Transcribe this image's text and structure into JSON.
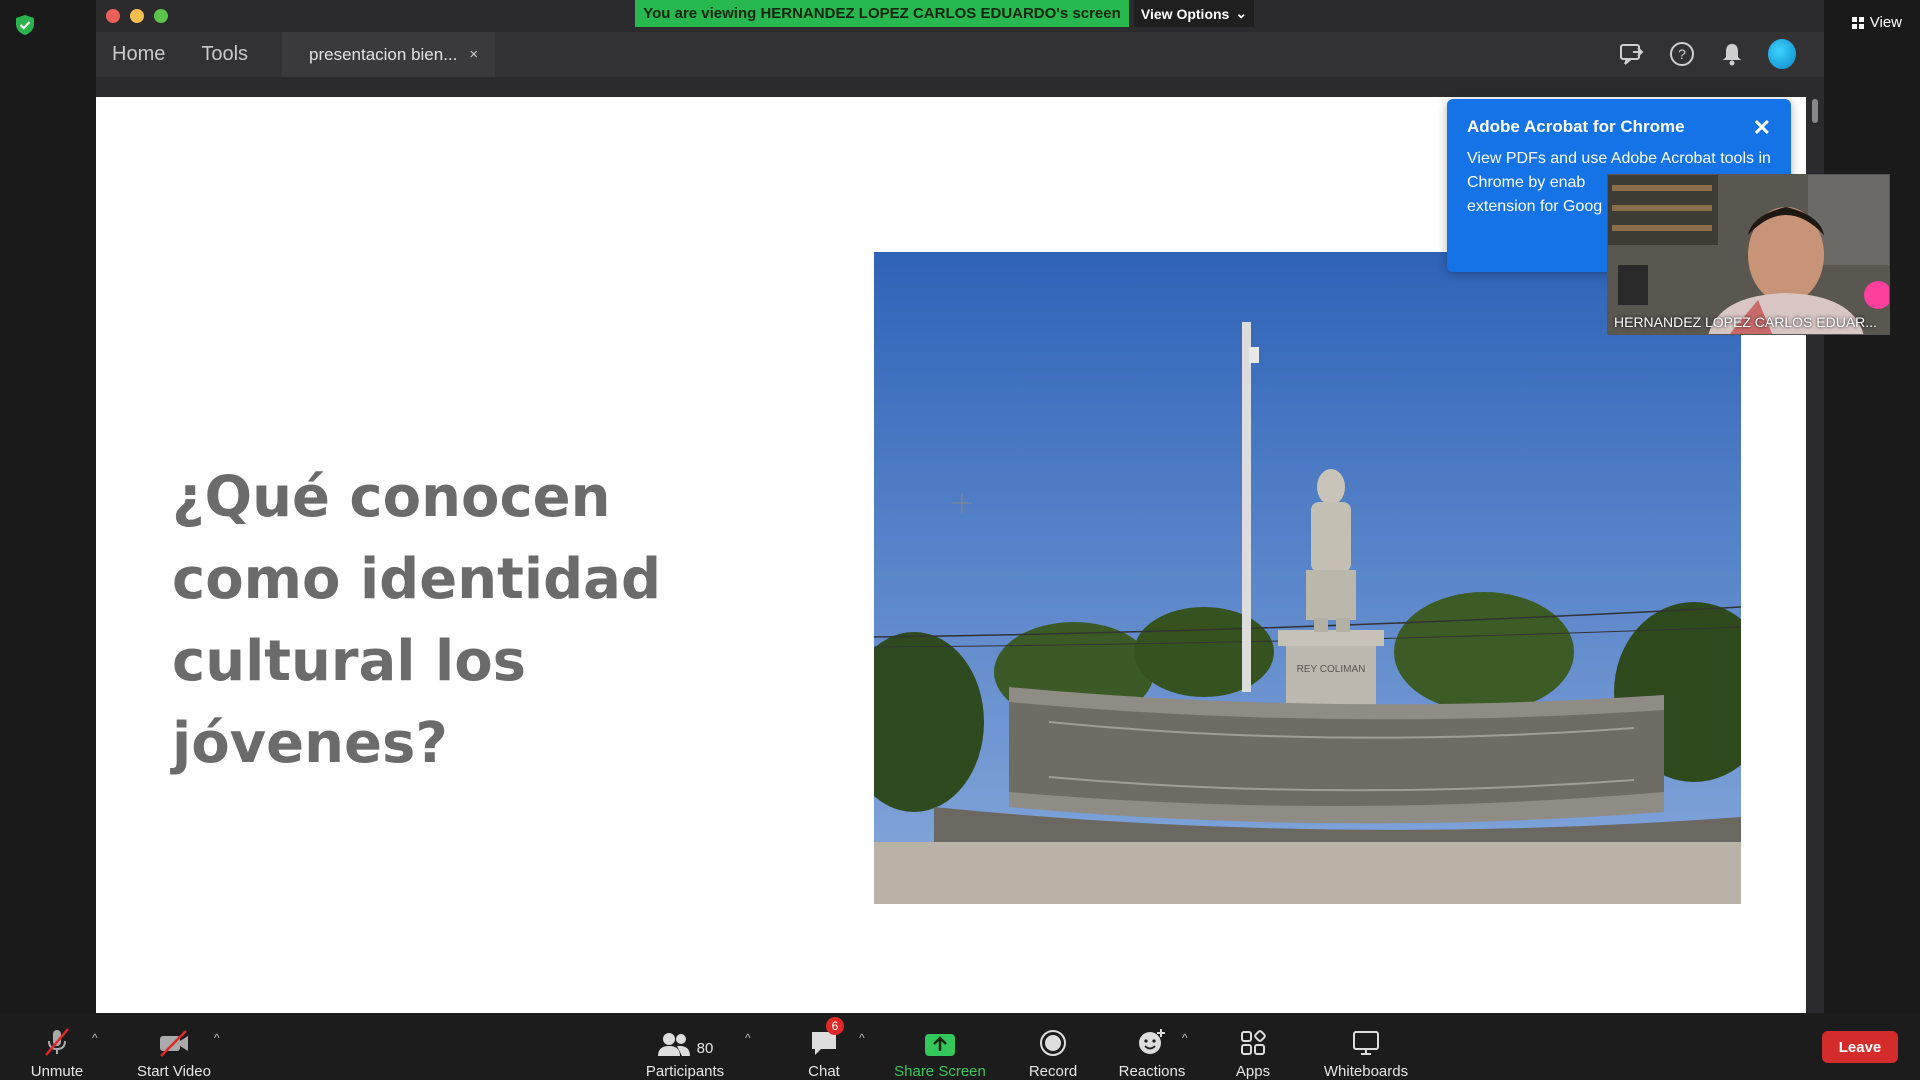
{
  "zoom": {
    "view_label": "View",
    "banner_text": "You are viewing HERNANDEZ LOPEZ CARLOS EDUARDO's screen",
    "view_options_label": "View Options",
    "view_options_caret": "⌄"
  },
  "acrobat": {
    "nav": {
      "home": "Home",
      "tools": "Tools"
    },
    "tab": {
      "title": "presentacion bien...",
      "close": "×"
    },
    "popup": {
      "title": "Adobe Acrobat for Chrome",
      "body": "View PDFs and use Adobe Acrobat tools in Chrome by enab",
      "body_line3": "extension for Goog",
      "close": "✕"
    }
  },
  "slide": {
    "heading": "¿Qué conocen como identidad cultural los jóvenes?",
    "photo_caption": "REY COLIMAN"
  },
  "video": {
    "participant_name": "HERNANDEZ LOPEZ CARLOS EDUAR..."
  },
  "controls": {
    "unmute": "Unmute",
    "start_video": "Start Video",
    "participants": "Participants",
    "participants_count": "80",
    "chat": "Chat",
    "chat_badge": "6",
    "share_screen": "Share Screen",
    "record": "Record",
    "reactions": "Reactions",
    "apps": "Apps",
    "whiteboards": "Whiteboards",
    "leave": "Leave",
    "caret": "^"
  },
  "colors": {
    "banner_green": "#27b84f",
    "share_green": "#34c759",
    "leave_red": "#d42b2b",
    "popup_blue": "#1473e6"
  }
}
